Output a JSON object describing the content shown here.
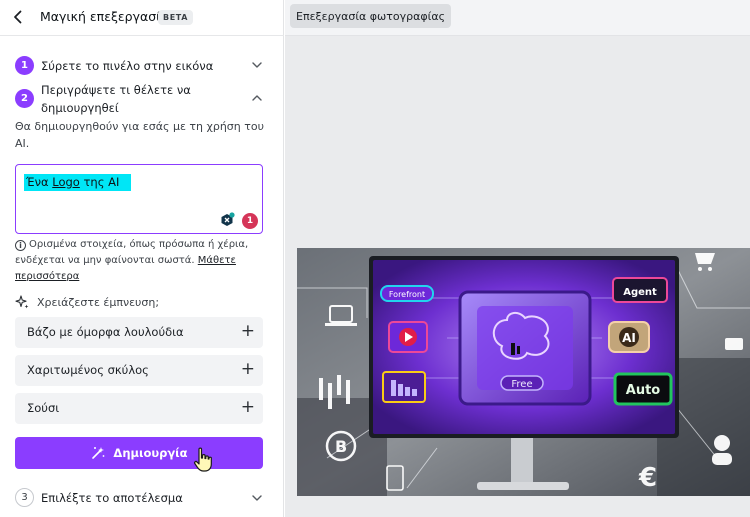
{
  "header": {
    "title": "Μαγική επεξεργασία",
    "badge": "BETA"
  },
  "steps": {
    "step1": {
      "number": "1",
      "label": "Σύρετε το πινέλο στην εικόνα"
    },
    "step2": {
      "number": "2",
      "label_line1": "Περιγράψετε τι θέλετε να",
      "label_line2": "δημιουργηθεί",
      "description": "Θα δημιουργηθούν για εσάς με τη χρήση του AI."
    },
    "step3": {
      "number": "3",
      "label": "Επιλέξτε το αποτέλεσμα"
    }
  },
  "prompt": {
    "part1": "Ένα ",
    "part2": "Logo",
    "part3": " της AI",
    "issue_count": "1"
  },
  "warning": {
    "text": "Ορισμένα στοιχεία, όπως πρόσωπα ή χέρια, ενδέχεται να μην φαίνονται σωστά.",
    "link": "Μάθετε περισσότερα"
  },
  "inspiration": {
    "title": "Χρειάζεστε έμπνευση;",
    "suggestions": [
      "Βάζο με όμορφα λουλούδια",
      "Χαριτωμένος σκύλος",
      "Σούσι"
    ]
  },
  "generate_button": {
    "label": "Δημιουργία"
  },
  "canvas": {
    "tab_label": "Επεξεργασία φωτογραφίας",
    "image_labels": [
      "Forefront",
      "Agent",
      "Free",
      "Auto",
      "AI"
    ]
  },
  "colors": {
    "accent": "#8b3dff",
    "highlight": "#00e6f6",
    "error_badge": "#d53558"
  }
}
